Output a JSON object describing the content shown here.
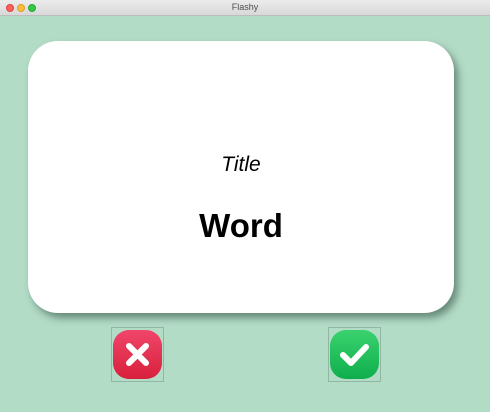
{
  "window": {
    "title": "Flashy"
  },
  "card": {
    "title": "Title",
    "word": "Word"
  },
  "buttons": {
    "wrong": {
      "icon": "cross-icon",
      "color": "#e8304f"
    },
    "right": {
      "icon": "checkmark-icon",
      "color": "#1dbe58"
    }
  },
  "colors": {
    "background": "#b3dcc7",
    "card": "#ffffff"
  }
}
